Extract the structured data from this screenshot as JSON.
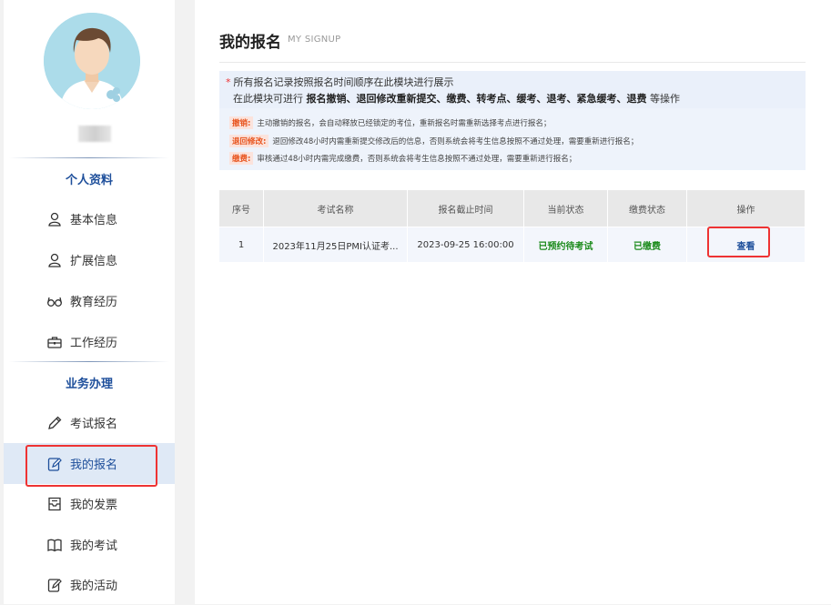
{
  "sidebar": {
    "sections": [
      {
        "title": "个人资料"
      },
      {
        "title": "业务办理"
      }
    ],
    "items": [
      {
        "label": "基本信息",
        "icon": "user-icon"
      },
      {
        "label": "扩展信息",
        "icon": "user-icon"
      },
      {
        "label": "教育经历",
        "icon": "glasses-icon"
      },
      {
        "label": "工作经历",
        "icon": "briefcase-icon"
      },
      {
        "label": "考试报名",
        "icon": "pencil-icon"
      },
      {
        "label": "我的报名",
        "icon": "edit-document-icon",
        "active": true
      },
      {
        "label": "我的发票",
        "icon": "invoice-icon"
      },
      {
        "label": "我的考试",
        "icon": "book-icon"
      },
      {
        "label": "我的活动",
        "icon": "edit-document-icon"
      }
    ]
  },
  "header": {
    "title": "我的报名",
    "subtitle": "MY SIGNUP"
  },
  "notice": {
    "star": "*",
    "line1": "所有报名记录按照报名时间顺序在此模块进行展示",
    "line2_prefix": "在此模块可进行",
    "line2_ops": "报名撤销、退回修改重新提交、缴费、转考点、缓考、退考、紧急缓考、退费",
    "line2_suffix": "等操作",
    "rules": [
      {
        "tag": "撤销:",
        "text": "主动撤销的报名，会自动释放已经锁定的考位，重新报名时需重新选择考点进行报名；"
      },
      {
        "tag": "退回修改:",
        "text": "退回修改48小时内需重新提交修改后的信息，否则系统会将考生信息按照不通过处理，需要重新进行报名；"
      },
      {
        "tag": "缴费:",
        "text": "审核通过48小时内需完成缴费，否则系统会将考生信息按照不通过处理，需要重新进行报名；"
      }
    ]
  },
  "table": {
    "headers": [
      "序号",
      "考试名称",
      "报名截止时间",
      "当前状态",
      "缴费状态",
      "操作"
    ],
    "rows": [
      {
        "index": "1",
        "name": "2023年11月25日PMI认证考...",
        "deadline": "2023-09-25 16:00:00",
        "status": "已预约待考试",
        "payment": "已缴费",
        "action": "查看"
      }
    ]
  },
  "colors": {
    "accent": "#1e4f9b",
    "highlight_red": "#e33333",
    "status_green": "#1a8a1a",
    "tag_orange": "#e8531c"
  }
}
